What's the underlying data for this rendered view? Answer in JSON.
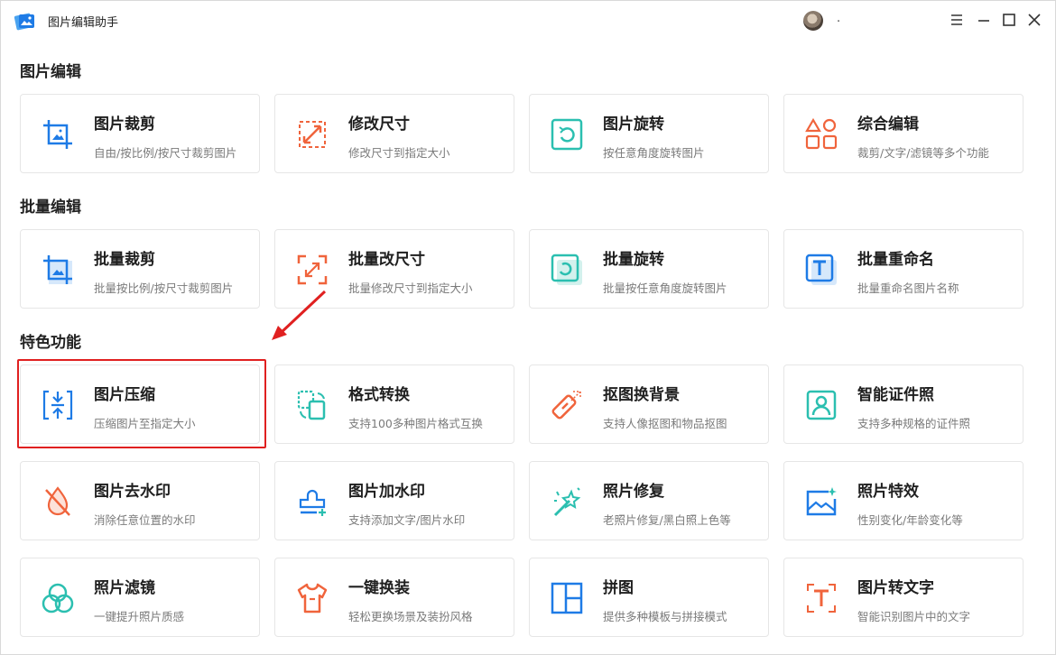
{
  "app": {
    "title": "图片编辑助手",
    "username": "."
  },
  "sections": [
    {
      "title": "图片编辑",
      "items": [
        {
          "title": "图片裁剪",
          "desc": "自由/按比例/按尺寸裁剪图片"
        },
        {
          "title": "修改尺寸",
          "desc": "修改尺寸到指定大小"
        },
        {
          "title": "图片旋转",
          "desc": "按任意角度旋转图片"
        },
        {
          "title": "综合编辑",
          "desc": "裁剪/文字/滤镜等多个功能"
        }
      ]
    },
    {
      "title": "批量编辑",
      "items": [
        {
          "title": "批量裁剪",
          "desc": "批量按比例/按尺寸裁剪图片"
        },
        {
          "title": "批量改尺寸",
          "desc": "批量修改尺寸到指定大小"
        },
        {
          "title": "批量旋转",
          "desc": "批量按任意角度旋转图片"
        },
        {
          "title": "批量重命名",
          "desc": "批量重命名图片名称"
        }
      ]
    },
    {
      "title": "特色功能",
      "items": [
        {
          "title": "图片压缩",
          "desc": "压缩图片至指定大小"
        },
        {
          "title": "格式转换",
          "desc": "支持100多种图片格式互换"
        },
        {
          "title": "抠图换背景",
          "desc": "支持人像抠图和物品抠图"
        },
        {
          "title": "智能证件照",
          "desc": "支持多种规格的证件照"
        },
        {
          "title": "图片去水印",
          "desc": "消除任意位置的水印"
        },
        {
          "title": "图片加水印",
          "desc": "支持添加文字/图片水印"
        },
        {
          "title": "照片修复",
          "desc": "老照片修复/黑白照上色等"
        },
        {
          "title": "照片特效",
          "desc": "性别变化/年龄变化等"
        },
        {
          "title": "照片滤镜",
          "desc": "一键提升照片质感"
        },
        {
          "title": "一键换装",
          "desc": "轻松更换场景及装扮风格"
        },
        {
          "title": "拼图",
          "desc": "提供多种模板与拼接模式"
        },
        {
          "title": "图片转文字",
          "desc": "智能识别图片中的文字"
        }
      ]
    }
  ],
  "colors": {
    "blue": "#1e7be6",
    "orange": "#f0643c",
    "teal": "#2bbfb0",
    "highlight": "#e02020"
  }
}
